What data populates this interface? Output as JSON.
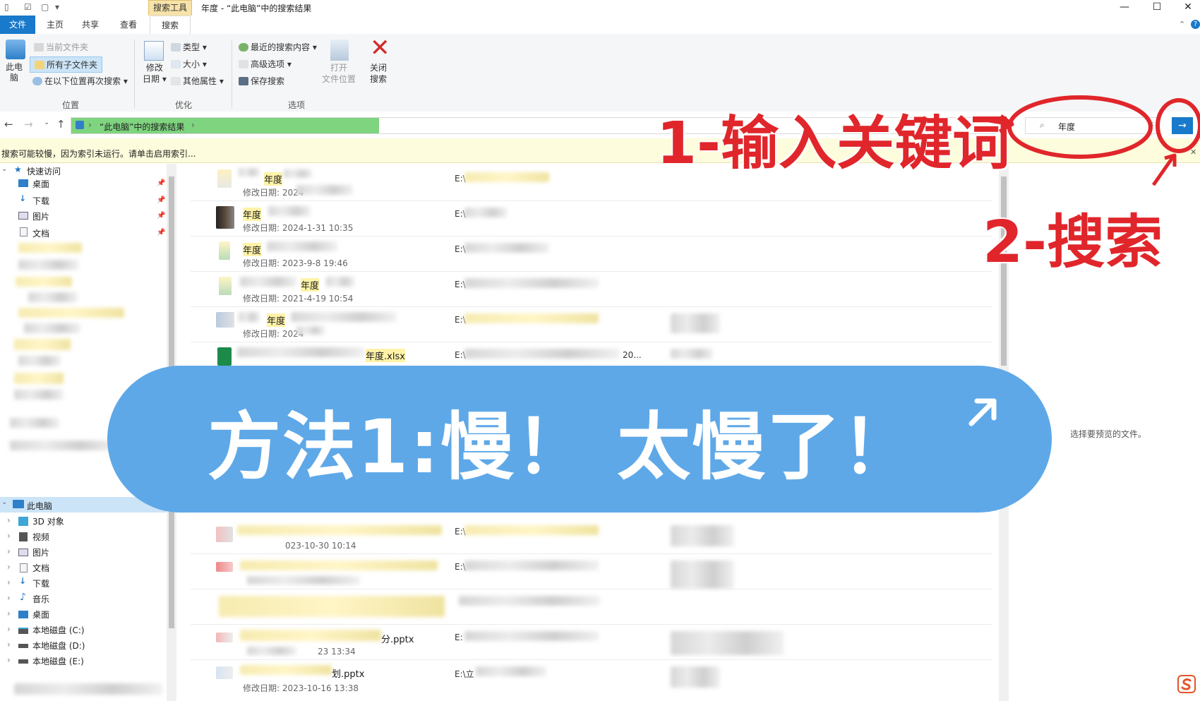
{
  "window": {
    "title": "年度 - “此电脑”中的搜索结果",
    "context_tab": "搜索工具",
    "controls": [
      "—",
      "☐",
      "✕"
    ]
  },
  "ribbon_tabs": [
    {
      "label": "文件"
    },
    {
      "label": "主页"
    },
    {
      "label": "共享"
    },
    {
      "label": "查看"
    },
    {
      "label": "搜索"
    }
  ],
  "ribbon": {
    "location": {
      "this_pc": "此电脑",
      "current_folder": "当前文件夹",
      "all_subfolders": "所有子文件夹",
      "search_again": "在以下位置再次搜索",
      "group_label": "位置"
    },
    "refine": {
      "modified_date_l1": "修改",
      "modified_date_l2": "日期",
      "type": "类型",
      "size": "大小",
      "other_props": "其他属性",
      "group_label": "优化"
    },
    "options": {
      "recent_searches": "最近的搜索内容",
      "advanced_options": "高级选项",
      "save_search": "保存搜索",
      "open_location_l1": "打开",
      "open_location_l2": "文件位置",
      "close_search_l1": "关闭",
      "close_search_l2": "搜索",
      "group_label": "选项"
    }
  },
  "address": {
    "path": "“此电脑”中的搜索结果",
    "search_value": "年度"
  },
  "info_bar": "搜索可能较慢，因为索引未运行。请单击启用索引...",
  "nav": {
    "quick_access": "快速访问",
    "quick_items": [
      "桌面",
      "下载",
      "图片",
      "文档"
    ],
    "this_pc": "此电脑",
    "pc_items": [
      "3D 对象",
      "视频",
      "图片",
      "文档",
      "下载",
      "音乐",
      "桌面",
      "本地磁盘 (C:)",
      "本地磁盘 (D:)",
      "本地磁盘 (E:)"
    ]
  },
  "files": [
    {
      "name": "年度",
      "date": "修改日期: 2024",
      "path": "E:\\"
    },
    {
      "name": "年度",
      "date": "修改日期: 2024-1-31 10:35",
      "path": "E:\\"
    },
    {
      "name": "年度",
      "date": "修改日期: 2023-9-8 19:46",
      "path": "E:\\"
    },
    {
      "name": "年度",
      "date": "修改日期: 2021-4-19 10:54",
      "path": "E:\\"
    },
    {
      "name": "年度",
      "date": "修改日期: 2024",
      "path": "E:\\"
    },
    {
      "name": "年度.xlsx",
      "date": "",
      "path": "E:\\",
      "extra": "20..."
    },
    {
      "name": "",
      "date": "023-10-30 10:14",
      "path": "E:\\"
    },
    {
      "name": "",
      "date": "",
      "path": "E:\\"
    },
    {
      "name": "分.pptx",
      "date": "23 13:34",
      "path": "E:"
    },
    {
      "name": "划.pptx",
      "date": "修改日期: 2023-10-16 13:38",
      "path": "E:\\立"
    }
  ],
  "preview": "选择要预览的文件。",
  "overlay": {
    "banner": "方法1:慢！ 太慢了！",
    "annotation_1": "1-输入关键词",
    "annotation_2": "2-搜索"
  },
  "colors": {
    "accent": "#1979ca",
    "banner": "#5ea8e8",
    "annotation": "#e0262b",
    "address_fill": "#7fd47f",
    "highlight": "#fff3a8",
    "info_bar": "#fdfcdc"
  }
}
